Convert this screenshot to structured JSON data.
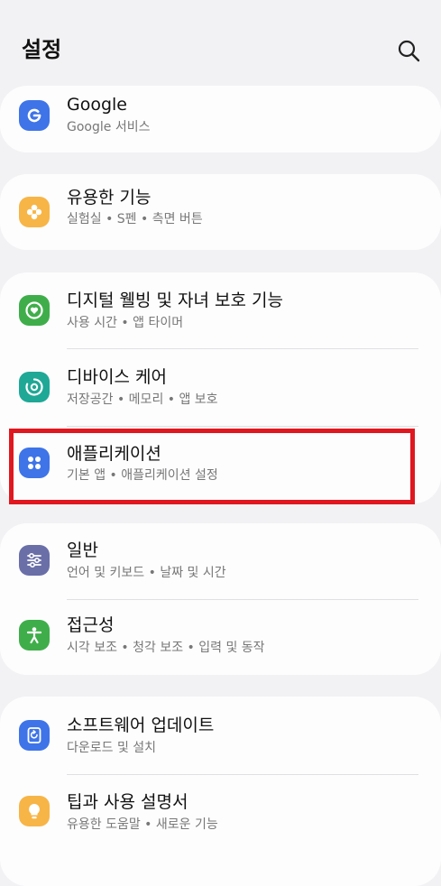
{
  "header": {
    "title": "설정",
    "search_icon": "search-icon"
  },
  "items": [
    {
      "label": "Google",
      "sub": "Google 서비스",
      "icon": "google-icon",
      "color": "#3e74e8"
    },
    {
      "label": "유용한 기능",
      "sub": "실험실  •  S펜  •  측면 버튼",
      "icon": "advanced-features-icon",
      "color": "#f7b547"
    },
    {
      "label": "디지털 웰빙 및 자녀 보호 기능",
      "sub": "사용 시간  •  앱 타이머",
      "icon": "digital-wellbeing-icon",
      "color": "#3fae4a"
    },
    {
      "label": "디바이스 케어",
      "sub": "저장공간  •  메모리  •  앱 보호",
      "icon": "device-care-icon",
      "color": "#1fa896"
    },
    {
      "label": "애플리케이션",
      "sub": "기본 앱  •  애플리케이션 설정",
      "icon": "apps-icon",
      "color": "#3e74e8"
    },
    {
      "label": "일반",
      "sub": "언어 및 키보드  •  날짜 및 시간",
      "icon": "general-management-icon",
      "color": "#6a6fa8"
    },
    {
      "label": "접근성",
      "sub": "시각 보조  •  청각 보조  •  입력 및 동작",
      "icon": "accessibility-icon",
      "color": "#3fae4a"
    },
    {
      "label": "소프트웨어 업데이트",
      "sub": "다운로드 및 설치",
      "icon": "software-update-icon",
      "color": "#3e74e8"
    },
    {
      "label": "팁과 사용 설명서",
      "sub": "유용한 도움말  •  새로운 기능",
      "icon": "tips-icon",
      "color": "#f7b547"
    }
  ],
  "highlight_color": "#e0171f"
}
